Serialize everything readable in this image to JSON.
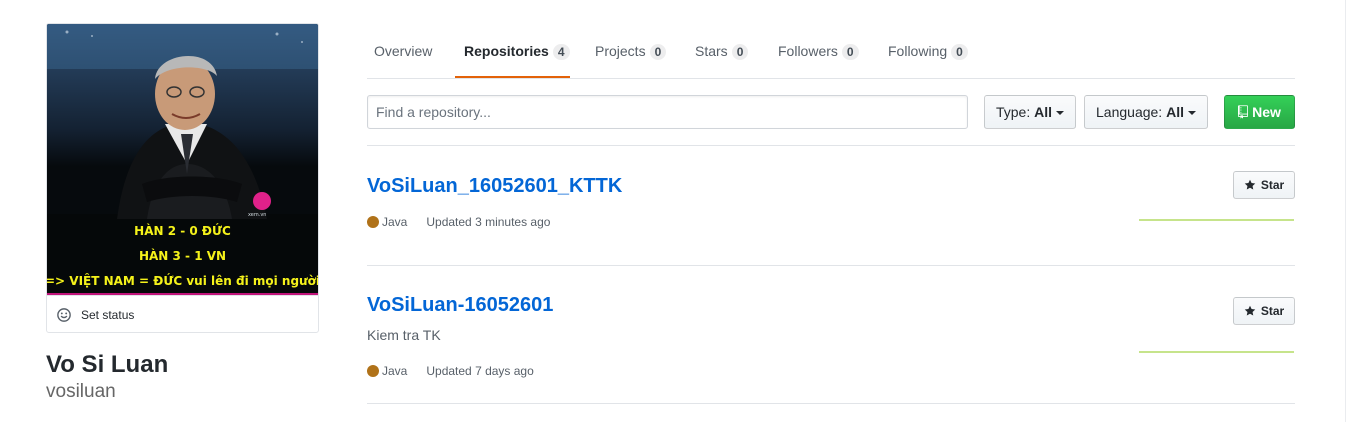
{
  "profile": {
    "avatar_lines": [
      "HÀN 2 - 0 ĐỨC",
      "HÀN 3 - 1 VN",
      "=> VIỆT NAM = ĐỨC vui lên đi mọi người"
    ],
    "avatar_watermark": "xem.vn",
    "status_label": "Set status",
    "full_name": "Vo Si Luan",
    "username": "vosiluan"
  },
  "tabs": [
    {
      "label": "Overview",
      "count": null
    },
    {
      "label": "Repositories",
      "count": "4",
      "selected": true
    },
    {
      "label": "Projects",
      "count": "0"
    },
    {
      "label": "Stars",
      "count": "0"
    },
    {
      "label": "Followers",
      "count": "0"
    },
    {
      "label": "Following",
      "count": "0"
    }
  ],
  "filters": {
    "search_placeholder": "Find a repository...",
    "type_label": "Type:",
    "type_value": "All",
    "language_label": "Language:",
    "language_value": "All",
    "new_label": "New"
  },
  "repos": [
    {
      "name": "VoSiLuan_16052601_KTTK",
      "description": "",
      "language": "Java",
      "updated": "Updated 3 minutes ago",
      "star_label": "Star"
    },
    {
      "name": "VoSiLuan-16052601",
      "description": "Kiem tra TK",
      "language": "Java",
      "updated": "Updated 7 days ago",
      "star_label": "Star"
    }
  ],
  "colors": {
    "accent_tab": "#e36209",
    "link": "#0366d6",
    "new_button": "#28a745",
    "java": "#b07219",
    "sparkline": "#c6e48b"
  },
  "icons": {
    "status": "smiley-icon",
    "new": "repo-icon",
    "star": "star-icon",
    "type_caret": "caret-down-icon",
    "language_caret": "caret-down-icon"
  }
}
